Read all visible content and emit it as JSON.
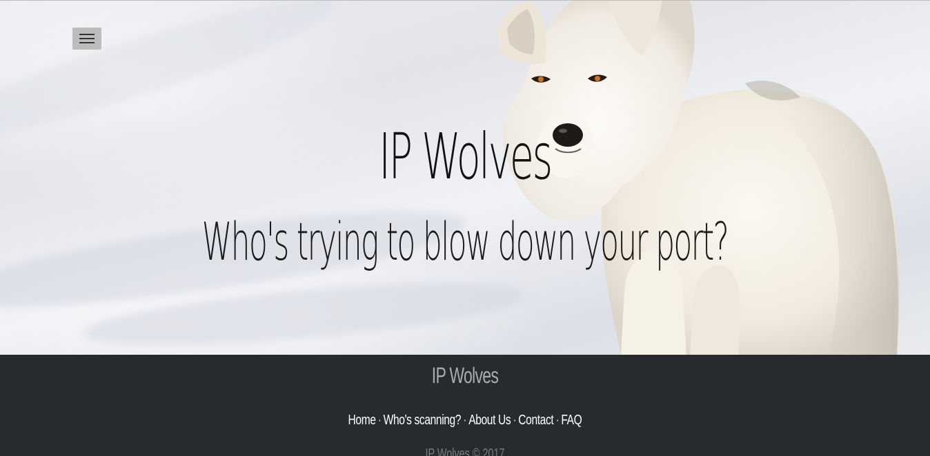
{
  "hero": {
    "title": "IP Wolves",
    "subtitle": "Who's trying to blow down your port?",
    "menu_icon": "hamburger-menu-icon",
    "image": "white arctic wolf standing in snow"
  },
  "footer": {
    "brand": "IP Wolves",
    "nav": [
      {
        "label": "Home"
      },
      {
        "label": "Who's scanning?"
      },
      {
        "label": "About Us"
      },
      {
        "label": "Contact"
      },
      {
        "label": "FAQ"
      }
    ],
    "separator": "·",
    "copyright": "IP Wolves © 2017"
  },
  "colors": {
    "footer_bg": "#282b2e",
    "footer_brand": "#a9abad",
    "footer_link": "#ffffff",
    "footer_copy": "#777b7f",
    "hero_text": "#111111"
  }
}
